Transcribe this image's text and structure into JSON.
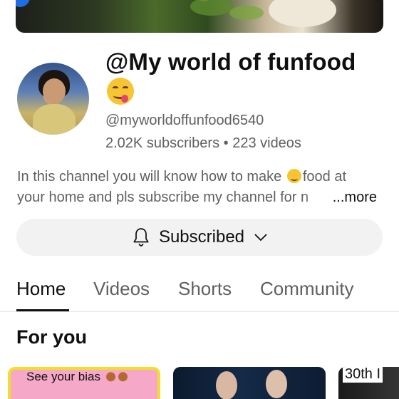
{
  "channel": {
    "name": "@My world of funfood",
    "handle": "@myworldoffunfood6540",
    "stats": "2.02K subscribers • 223 videos",
    "description_line1_a": "In this channel you will know how to make",
    "description_line1_b": "food at",
    "description_line2": "your home and pls subscribe my channel for n",
    "more_label": "...more"
  },
  "subscribe": {
    "label": "Subscribed"
  },
  "tabs": [
    "Home",
    "Videos",
    "Shorts",
    "Community"
  ],
  "section": {
    "title": "For you"
  },
  "thumbnails": [
    {
      "caption": "See your bias"
    },
    {
      "caption": ""
    },
    {
      "caption": "30th I"
    }
  ],
  "icons": {
    "bell": "bell-icon",
    "chevron": "chevron-down-icon",
    "emoji": "face-savoring-food-emoji"
  },
  "colors": {
    "primary_text": "#0f0f0f",
    "secondary_text": "#606060",
    "button_bg": "#f2f2f2"
  }
}
